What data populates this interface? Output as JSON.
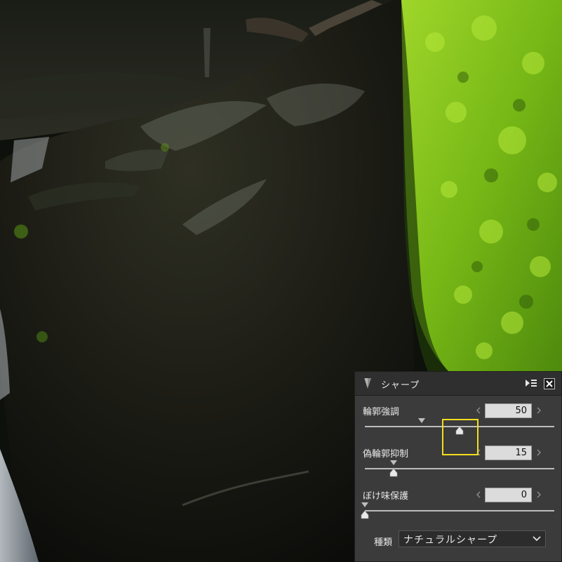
{
  "panel": {
    "title": "シャープ",
    "sliders": [
      {
        "label": "輪郭強調",
        "value": "50",
        "level": 50,
        "default_level": 30
      },
      {
        "label": "偽輪郭抑制",
        "value": "15",
        "level": 15,
        "default_level": 15
      },
      {
        "label": "ぼけ味保護",
        "value": "0",
        "level": 0,
        "default_level": 0
      }
    ],
    "type_label": "種類",
    "type_value": "ナチュラルシャープ"
  },
  "colors": {
    "panel_bg": "#3b3b3b",
    "header_bg": "#2f2f2f",
    "highlight": "#f2dd1f",
    "moss": "#7fbf1a"
  },
  "icons": [
    "collapse-triangle-icon",
    "panel-menu-icon",
    "close-icon",
    "decrement-arrow-icon",
    "increment-arrow-icon",
    "chevron-down-icon"
  ]
}
